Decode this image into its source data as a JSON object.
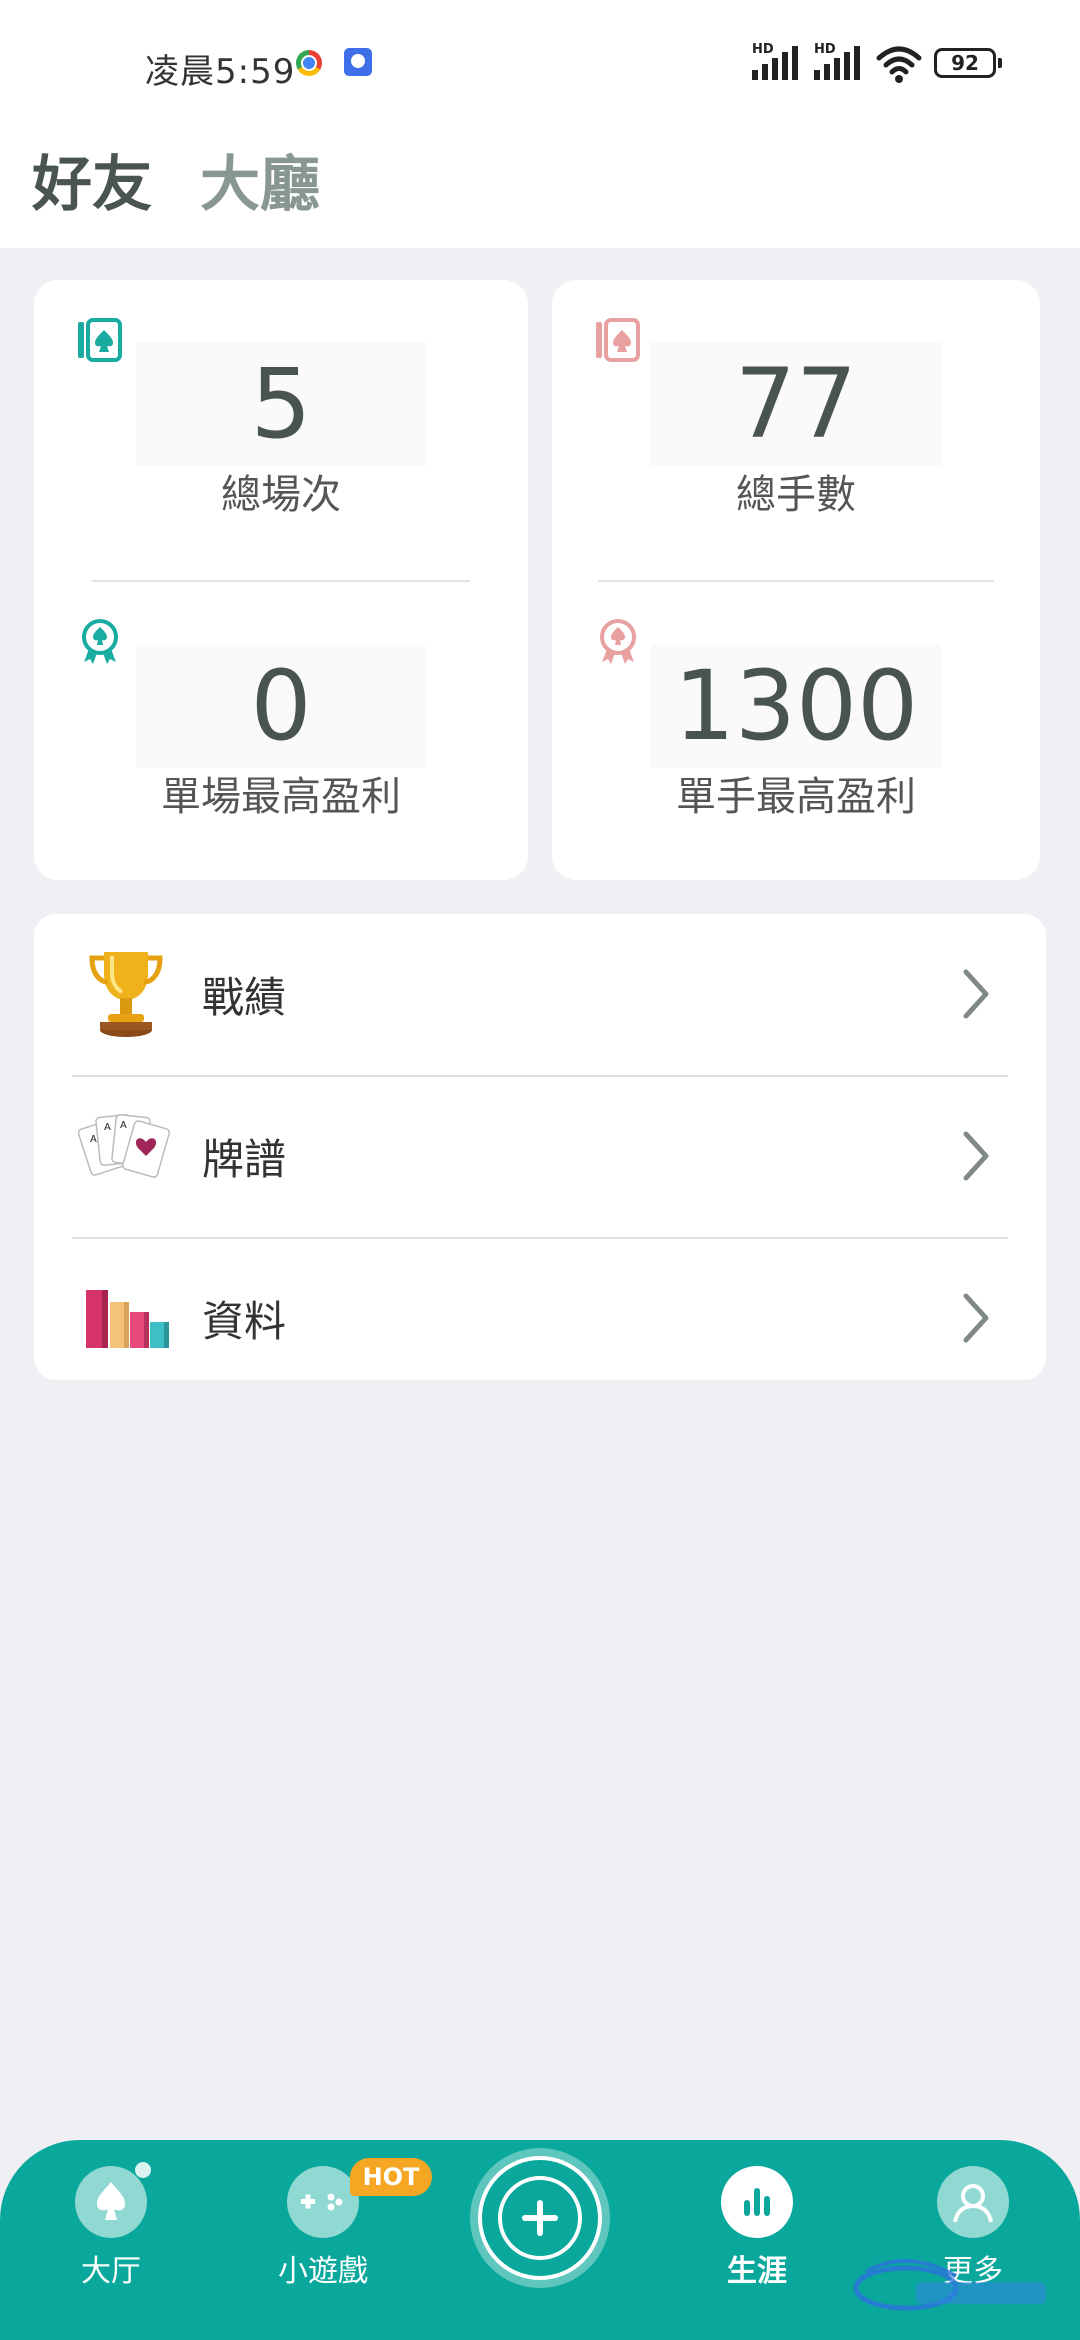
{
  "status_bar": {
    "time": "凌晨5:59",
    "battery": "92",
    "network_label": "HD"
  },
  "header": {
    "tabs": [
      {
        "label": "好友"
      },
      {
        "label": "大廳"
      }
    ]
  },
  "stats": {
    "total_games": {
      "value": "5",
      "label": "總場次"
    },
    "total_hands": {
      "value": "77",
      "label": "總手數"
    },
    "best_game_profit": {
      "value": "0",
      "label": "單場最高盈利"
    },
    "best_hand_profit": {
      "value": "1300",
      "label": "單手最高盈利"
    },
    "colors": {
      "teal": "#1aaca0",
      "pink": "#e8a0a0"
    }
  },
  "menu": {
    "items": [
      {
        "label": "戰績",
        "icon": "trophy-icon"
      },
      {
        "label": "牌譜",
        "icon": "playing-cards-icon"
      },
      {
        "label": "資料",
        "icon": "bar-chart-icon"
      }
    ]
  },
  "bottom_nav": {
    "items": [
      {
        "label": "大厅",
        "icon": "spade-icon"
      },
      {
        "label": "小遊戲",
        "icon": "gamepad-icon",
        "badge": "HOT"
      },
      {
        "label": "生涯",
        "icon": "stats-icon",
        "active": true
      },
      {
        "label": "更多",
        "icon": "user-icon"
      }
    ],
    "center_icon": "plus-icon",
    "accent": "#0aa89c"
  }
}
